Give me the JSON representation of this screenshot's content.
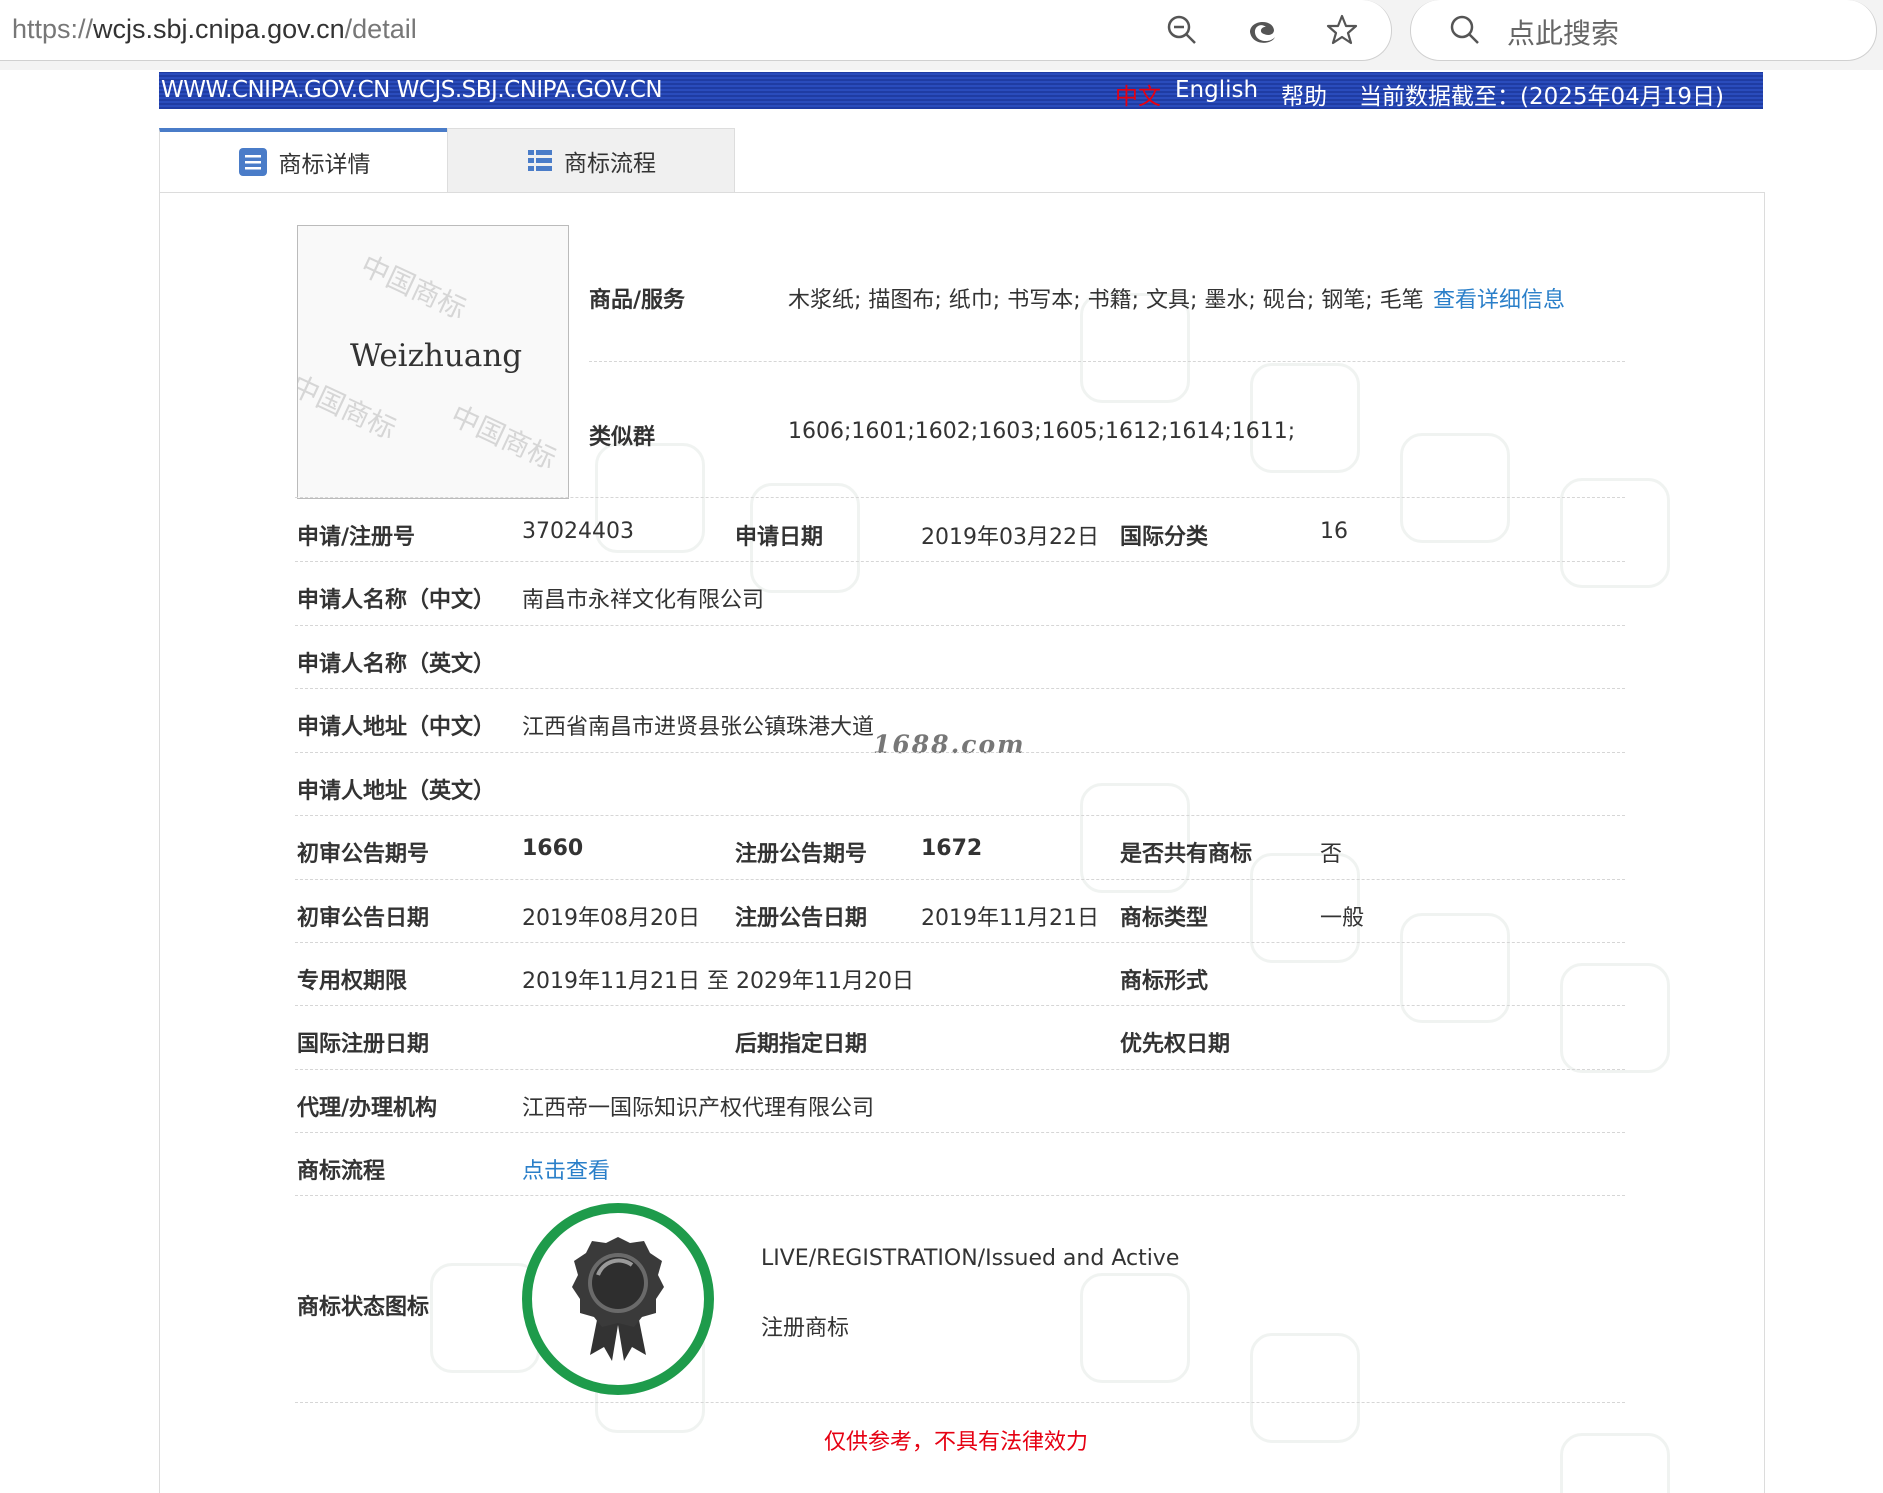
{
  "browser": {
    "url_scheme": "https://",
    "url_host": "wcjs.sbj.cnipa.gov.cn",
    "url_path": "/detail",
    "search_placeholder": "点此搜索"
  },
  "banner": {
    "site": "WWW.CNIPA.GOV.CN WCJS.SBJ.CNIPA.GOV.CN",
    "lang_cn": "中文",
    "lang_en": "English",
    "help": "帮助",
    "cutoff": "当前数据截至：(2025年04月19日)"
  },
  "tabs": [
    {
      "label": "商标详情",
      "active": true
    },
    {
      "label": "商标流程",
      "active": false
    }
  ],
  "mark": {
    "word": "Weizhuang",
    "image_watermark": "中国商标"
  },
  "details": {
    "goods_label": "商品/服务",
    "goods_value": "木浆纸; 描图布; 纸巾; 书写本; 书籍; 文具; 墨水; 砚台; 钢笔; 毛笔",
    "goods_link": "查看详细信息",
    "similar_label": "类似群",
    "similar_value": "1606;1601;1602;1603;1605;1612;1614;1611;",
    "reg_no_label": "申请/注册号",
    "reg_no": "37024403",
    "app_date_label": "申请日期",
    "app_date": "2019年03月22日",
    "intl_class_label": "国际分类",
    "intl_class": "16",
    "applicant_cn_label": "申请人名称（中文）",
    "applicant_cn": "南昌市永祥文化有限公司",
    "applicant_en_label": "申请人名称（英文）",
    "addr_cn_label": "申请人地址（中文）",
    "addr_cn": "江西省南昌市进贤县张公镇珠港大道",
    "addr_en_label": "申请人地址（英文）",
    "prelim_no_label": "初审公告期号",
    "prelim_no": "1660",
    "reg_pub_no_label": "注册公告期号",
    "reg_pub_no": "1672",
    "shared_label": "是否共有商标",
    "shared": "否",
    "prelim_date_label": "初审公告日期",
    "prelim_date": "2019年08月20日",
    "reg_pub_date_label": "注册公告日期",
    "reg_pub_date": "2019年11月21日",
    "mark_type_label": "商标类型",
    "mark_type": "一般",
    "term_label": "专用权期限",
    "term": "2019年11月21日 至 2029年11月20日",
    "mark_form_label": "商标形式",
    "intl_reg_date_label": "国际注册日期",
    "later_date_label": "后期指定日期",
    "priority_date_label": "优先权日期",
    "agent_label": "代理/办理机构",
    "agent": "江西帝一国际知识产权代理有限公司",
    "process_label": "商标流程",
    "process_link": "点击查看",
    "status_icon_label": "商标状态图标",
    "status_en": "LIVE/REGISTRATION/Issued and Active",
    "status_cn": "注册商标"
  },
  "site_watermark": "1688.com",
  "footer_note": "仅供参考，不具有法律效力",
  "colors": {
    "banner_blue": "#2a4cbc",
    "link_blue": "#2a7fc9",
    "badge_green": "#1e9b4b",
    "alert_red": "#e60012"
  }
}
